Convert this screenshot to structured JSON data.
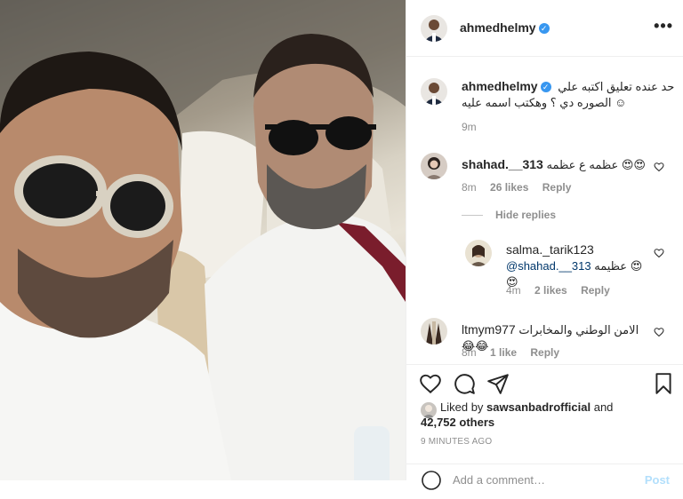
{
  "post": {
    "username": "ahmedhelmy",
    "verified_icon": "verified-badge-icon",
    "more_label": "•••",
    "caption_line1": "حد عنده تعليق اكتبه علي",
    "caption_line2": "الصوره دي ؟ وهكتب اسمه عليه ☺",
    "caption_time": "9m"
  },
  "comments": [
    {
      "username": "shahad.__313",
      "text": "عظمه ع عظمه 😍😍",
      "time": "8m",
      "likes": "26 likes",
      "reply": "Reply"
    },
    {
      "username": "salma._tarik123",
      "mention": "@shahad.__313",
      "text": "عظيمه 😍😍",
      "time": "4m",
      "likes": "2 likes",
      "reply": "Reply"
    },
    {
      "username": "ltmym977",
      "text": "الامن الوطني والمخابرات 😂😂",
      "time": "8m",
      "likes": "1 like",
      "reply": "Reply"
    }
  ],
  "hide_replies": "Hide replies",
  "liked_by": {
    "prefix": "Liked by",
    "user": "sawsanbadrofficial",
    "and": "and",
    "count": "42,752 others"
  },
  "timestamp": "9 MINUTES AGO",
  "add_comment": {
    "placeholder": "Add a comment…",
    "post_label": "Post"
  },
  "colors": {
    "link_blue": "#3897f0",
    "post_disabled": "#b2dffc",
    "muted": "#8e8e8e"
  }
}
